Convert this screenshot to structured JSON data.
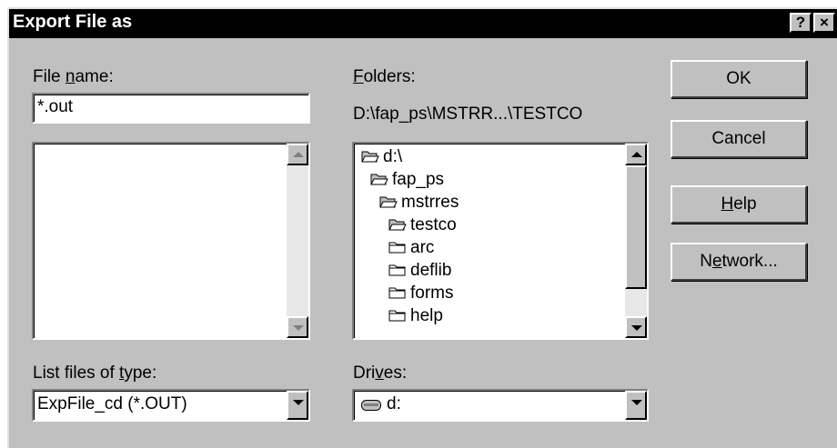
{
  "window": {
    "title": "Export File as",
    "help_btn": "?",
    "close_btn": "×"
  },
  "file_name": {
    "label_pre": "File ",
    "label_accel": "n",
    "label_post": "ame:",
    "value": "*.out"
  },
  "folders": {
    "label_accel": "F",
    "label_post": "olders:",
    "path": "D:\\fap_ps\\MSTRR...\\TESTCO",
    "items": [
      {
        "label": "d:\\",
        "open": true
      },
      {
        "label": "fap_ps",
        "open": true
      },
      {
        "label": "mstrres",
        "open": true
      },
      {
        "label": "testco",
        "open": true
      },
      {
        "label": "arc",
        "open": false
      },
      {
        "label": "deflib",
        "open": false
      },
      {
        "label": "forms",
        "open": false
      },
      {
        "label": "help",
        "open": false
      }
    ]
  },
  "file_type": {
    "label_pre": "List files of ",
    "label_accel": "t",
    "label_post": "ype:",
    "value": "ExpFile_cd (*.OUT)"
  },
  "drives": {
    "label_pre": "Dri",
    "label_accel": "v",
    "label_post": "es:",
    "value": "d:"
  },
  "buttons": {
    "ok": "OK",
    "cancel": "Cancel",
    "help_accel": "H",
    "help_post": "elp",
    "network_pre": "N",
    "network_accel": "e",
    "network_post": "twork..."
  },
  "colors": {
    "face": "#c0c0c0",
    "titlebar": "#000000"
  },
  "icons": {
    "folder_open": "open-folder-icon",
    "folder_closed": "closed-folder-icon",
    "drive": "drive-icon"
  }
}
